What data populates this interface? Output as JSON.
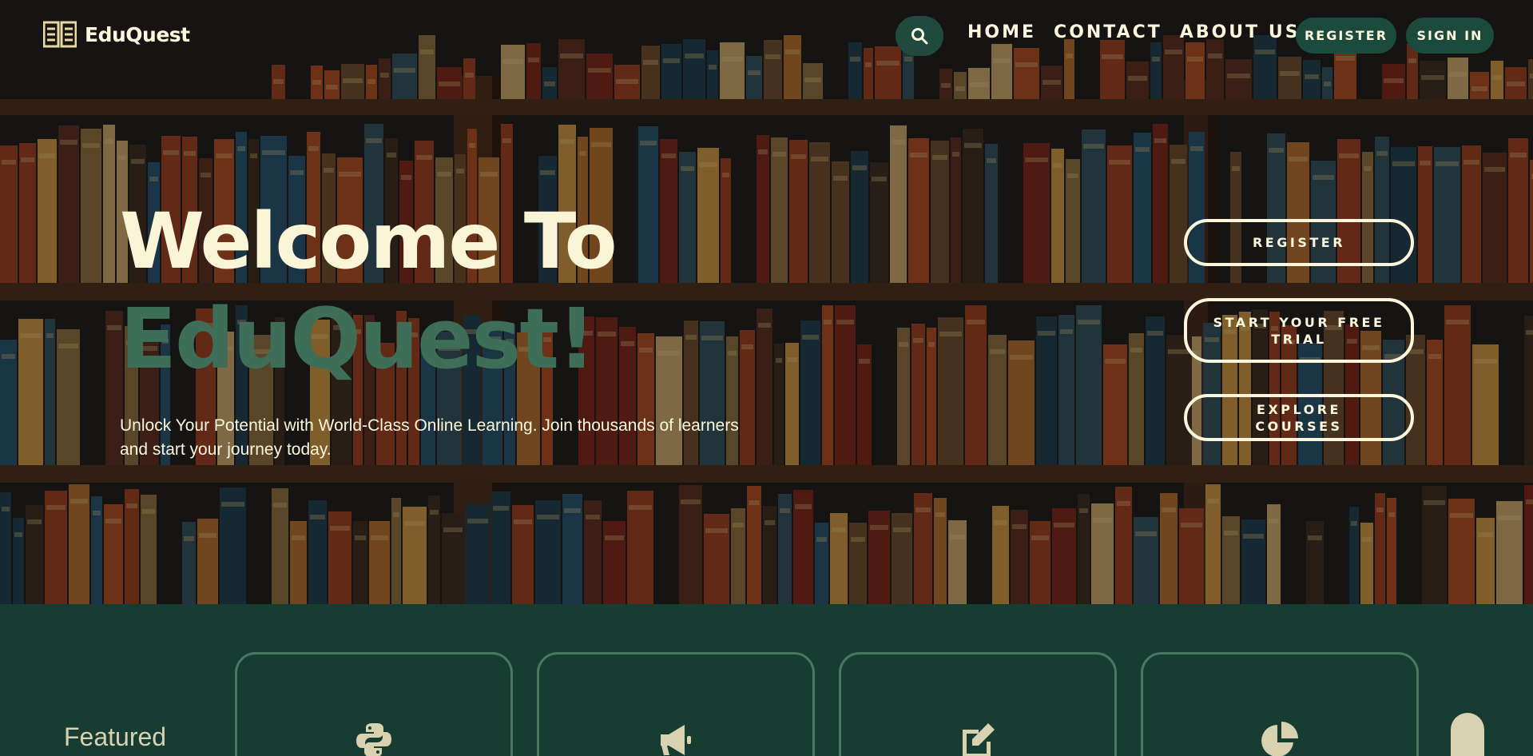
{
  "brand": {
    "name": "EduQuest"
  },
  "nav": {
    "links": [
      "HOME",
      "CONTACT",
      "ABOUT US"
    ],
    "register": "REGISTER",
    "signin": "SIGN IN"
  },
  "hero": {
    "title_line1": "Welcome To",
    "title_line2": "EduQuest!",
    "tagline": "Unlock Your Potential with World-Class Online Learning. Join thousands of learners and start your journey today.",
    "cta": [
      "REGISTER",
      "START YOUR FREE TRIAL",
      "EXPLORE COURSES"
    ]
  },
  "featured": {
    "title": "Featured",
    "cards": [
      {
        "icon": "python-icon"
      },
      {
        "icon": "megaphone-icon"
      },
      {
        "icon": "edit-icon"
      },
      {
        "icon": "pie-chart-icon"
      }
    ]
  },
  "colors": {
    "cream": "#fbf6dc",
    "dark_green": "#173d33",
    "accent_green": "#3e6e57",
    "card_border": "#4a7762"
  }
}
